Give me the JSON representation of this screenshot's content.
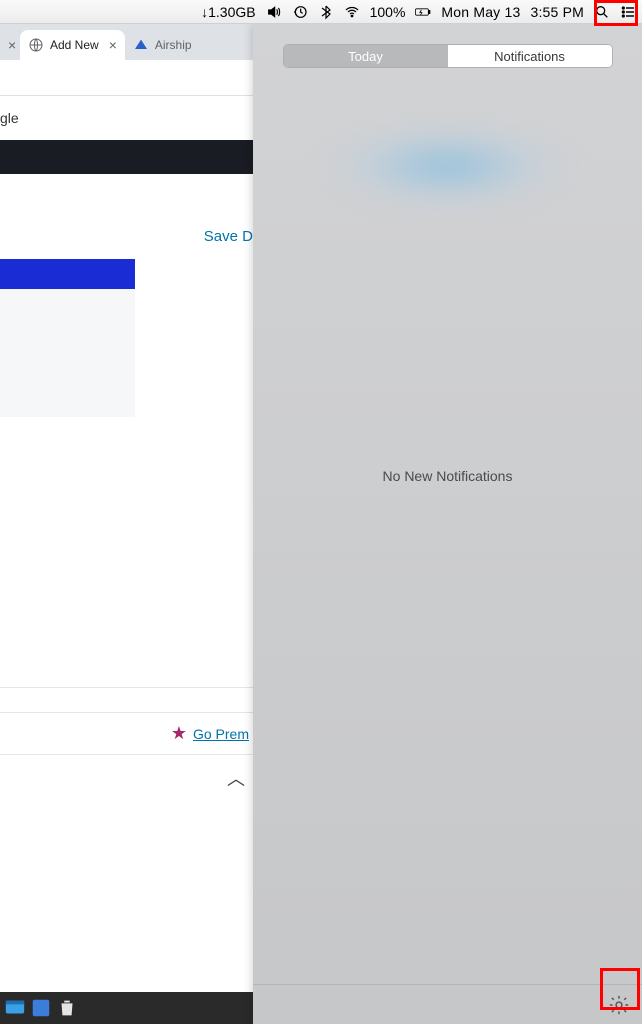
{
  "menubar": {
    "download_speed": "↓1.30GB",
    "battery_pct": "100%",
    "date": "Mon May 13",
    "time": "3:55 PM"
  },
  "browser": {
    "tabs": [
      {
        "label": "Add New",
        "active": true
      },
      {
        "label": "Airship",
        "active": false
      }
    ],
    "page": {
      "gle_fragment": "gle",
      "save_link": "Save D",
      "premium_link": "Go Prem"
    }
  },
  "notification_center": {
    "tabs": {
      "today": "Today",
      "notifications": "Notifications"
    },
    "empty_text": "No New Notifications"
  }
}
